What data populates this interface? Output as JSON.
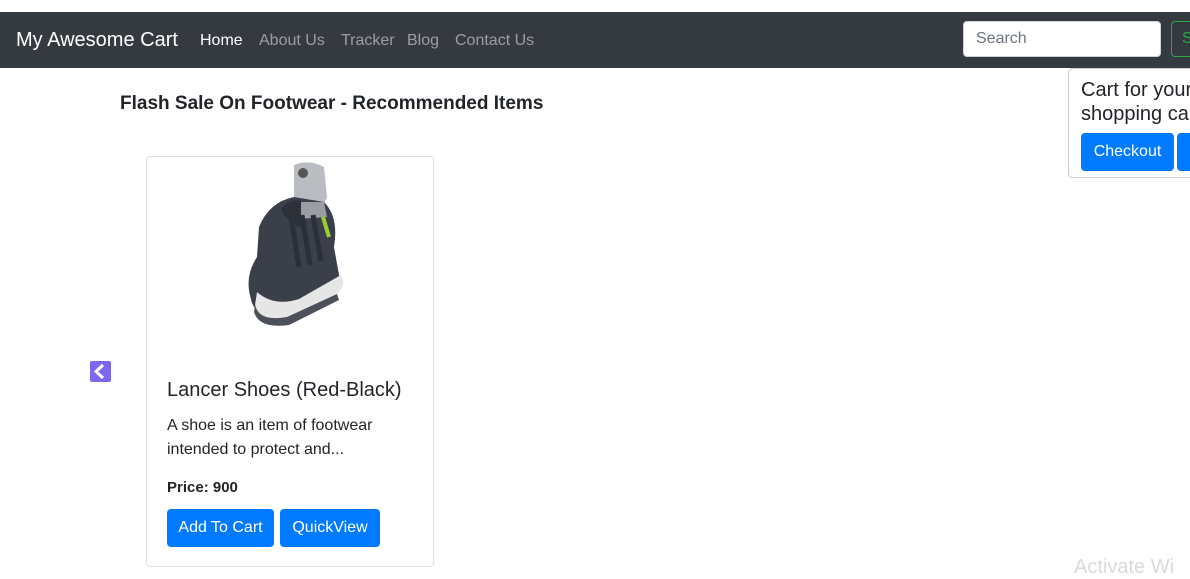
{
  "navbar": {
    "brand": "My Awesome Cart",
    "links": [
      {
        "label": "Home",
        "active": true
      },
      {
        "label": "About Us",
        "active": false
      },
      {
        "label": "Tracker",
        "active": false
      },
      {
        "label": "Blog",
        "active": false
      },
      {
        "label": "Contact Us",
        "active": false
      }
    ],
    "search_placeholder": "Search",
    "search_button": "S"
  },
  "cart_popover": {
    "title": "Cart for your shopping cart",
    "checkout_label": "Checkout"
  },
  "section": {
    "title": "Flash Sale On Footwear - Recommended Items"
  },
  "product": {
    "title": "Lancer Shoes (Red-Black)",
    "description": "A shoe is an item of footwear intended to protect and...",
    "price": "Price: 900",
    "add_to_cart_label": "Add To Cart",
    "quickview_label": "QuickView"
  },
  "watermark": "Activate Wi",
  "colors": {
    "navbar_bg": "#343a40",
    "primary": "#007bff",
    "success": "#28a745",
    "carousel_arrow": "#7b68ee"
  }
}
